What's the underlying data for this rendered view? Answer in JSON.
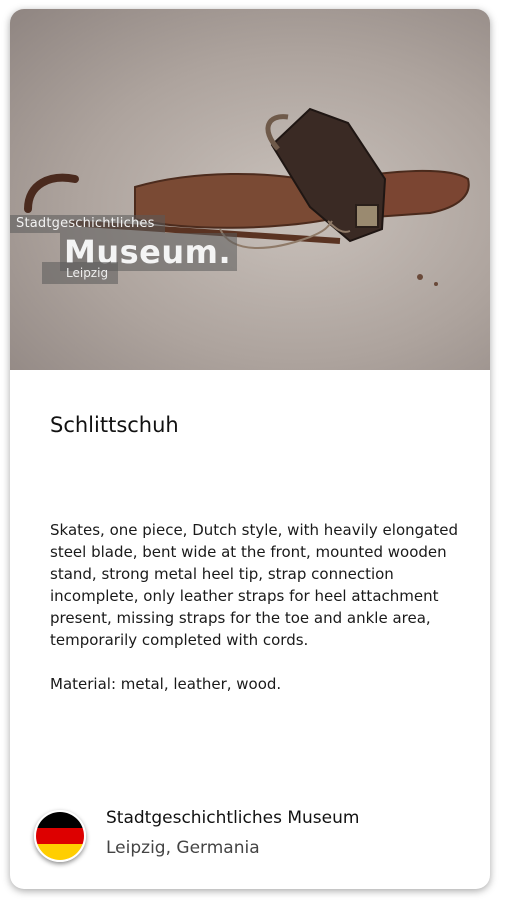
{
  "card": {
    "image": {
      "alt": "Schlittschuh",
      "watermark": {
        "line1": "Stadtgeschichtliches",
        "line2": "Museum.",
        "line3": "Leipzig"
      }
    },
    "title": "Schlittschuh",
    "description": [
      "Skates, one piece, Dutch style, with heavily elongated steel blade, bent wide at the front, mounted wooden stand, strong metal heel tip, strap connection incomplete, only leather straps for heel attachment present, missing straps for the toe and ankle area, temporarily completed with cords.",
      "Material: metal, leather, wood."
    ],
    "footer": {
      "flag_icon": "germany-flag-icon",
      "flag_colors": [
        "#000000",
        "#dd0000",
        "#ffce00"
      ],
      "museum_name": "Stadtgeschichtliches Museum",
      "location": "Leipzig, Germania"
    }
  }
}
